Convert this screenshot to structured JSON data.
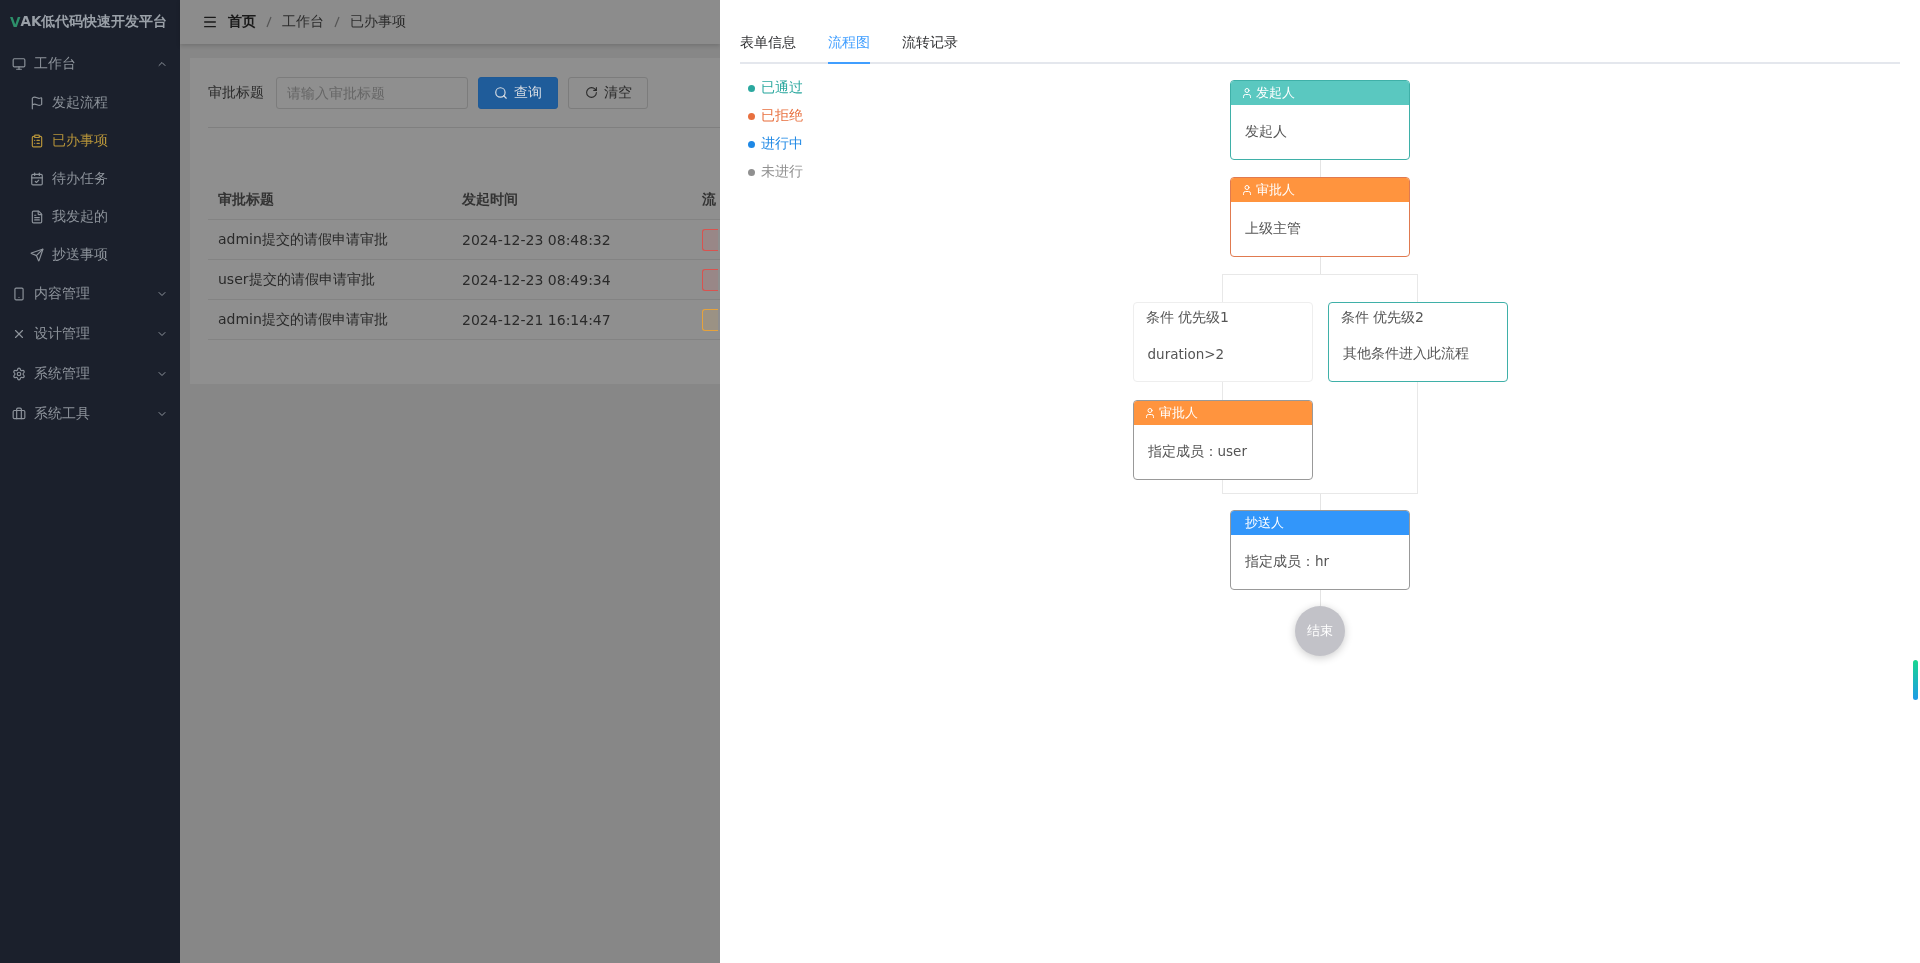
{
  "sidebar": {
    "logo_letter": "V",
    "title": "AK低代码快速开发平台",
    "menu": [
      {
        "label": "工作台",
        "expanded": true,
        "children": [
          {
            "label": "发起流程",
            "selected": false
          },
          {
            "label": "已办事项",
            "selected": true
          },
          {
            "label": "待办任务",
            "selected": false
          },
          {
            "label": "我发起的",
            "selected": false
          },
          {
            "label": "抄送事项",
            "selected": false
          }
        ]
      },
      {
        "label": "内容管理",
        "expanded": false
      },
      {
        "label": "设计管理",
        "expanded": false
      },
      {
        "label": "系统管理",
        "expanded": false
      },
      {
        "label": "系统工具",
        "expanded": false
      }
    ]
  },
  "breadcrumb": [
    "首页",
    "工作台",
    "已办事项"
  ],
  "filter": {
    "label": "审批标题",
    "placeholder": "请输入审批标题",
    "search_button": "查询",
    "clear_button": "清空"
  },
  "table": {
    "columns": [
      "审批标题",
      "发起时间",
      "流"
    ],
    "rows": [
      {
        "title": "admin提交的请假申请审批",
        "time": "2024-12-23 08:48:32",
        "color": "#d9534f"
      },
      {
        "title": "user提交的请假申请审批",
        "time": "2024-12-23 08:49:34",
        "color": "#d9534f"
      },
      {
        "title": "admin提交的请假申请审批",
        "time": "2024-12-21 16:14:47",
        "color": "#e6a23c"
      }
    ]
  },
  "drawer": {
    "tabs": [
      {
        "label": "表单信息",
        "selected": false
      },
      {
        "label": "流程图",
        "selected": true
      },
      {
        "label": "流转记录",
        "selected": false
      }
    ],
    "legend": [
      {
        "label": "已通过",
        "color": "#2ba89f"
      },
      {
        "label": "已拒绝",
        "color": "#e8703f"
      },
      {
        "label": "进行中",
        "color": "#1e88e5"
      },
      {
        "label": "未进行",
        "color": "#909090"
      }
    ],
    "flow": {
      "nodes": [
        {
          "kind": "start",
          "title": "发起人",
          "body": "发起人",
          "color": "#3fb0a8"
        },
        {
          "kind": "approver",
          "title": "审批人",
          "body": "上级主管",
          "color": "#e07a50"
        }
      ],
      "branches": [
        {
          "condition": {
            "title": "条件 优先级1",
            "body": "duration>2",
            "color": "#eeeeee"
          },
          "nodes": [
            {
              "kind": "approver",
              "title": "审批人",
              "body": "指定成员：user",
              "color": "#999999"
            }
          ]
        },
        {
          "condition": {
            "title": "条件 优先级2",
            "body": "其他条件进入此流程",
            "color": "#3fb0a8"
          }
        }
      ],
      "after": [
        {
          "kind": "cc",
          "title": "抄送人",
          "body": "指定成员：hr",
          "color": "#999999"
        }
      ],
      "end": "结束"
    }
  }
}
